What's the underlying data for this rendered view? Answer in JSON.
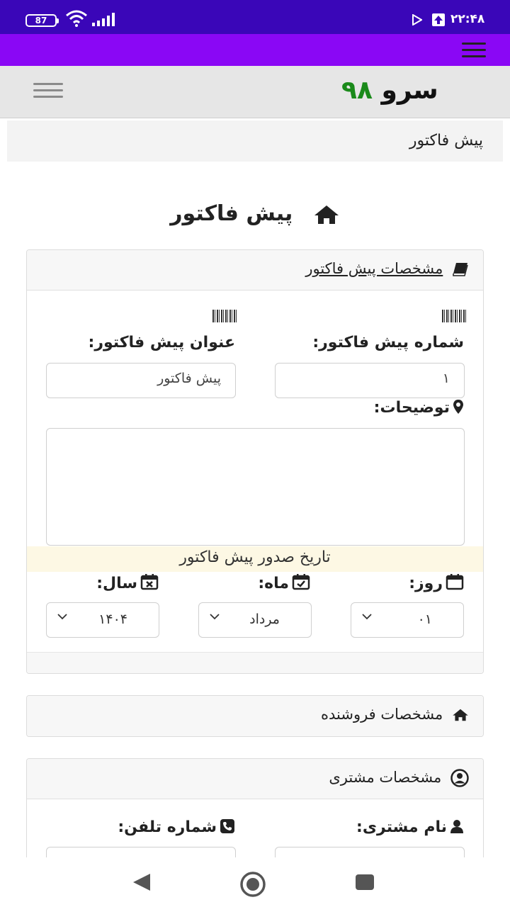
{
  "status_bar": {
    "battery": "87",
    "time": "۲۲:۴۸"
  },
  "header": {
    "logo_word": "سرو",
    "logo_number": "۹۸"
  },
  "breadcrumb": {
    "current": "پیش فاکتور"
  },
  "page": {
    "title": "پیش فاکتور"
  },
  "invoice_card": {
    "header": "مشخصات پیش فاکتور",
    "number_label": "شماره پیش فاکتور:",
    "number_value": "۱",
    "title_label": "عنوان پیش فاکتور:",
    "title_value": "پیش فاکتور",
    "description_label": "توضیحات:",
    "date_section_label": "تاریخ صدور پیش فاکتور",
    "day_label": "روز:",
    "day_value": "۰۱",
    "month_label": "ماه:",
    "month_value": "مرداد",
    "year_label": "سال:",
    "year_value": "۱۴۰۴"
  },
  "seller_card": {
    "header": "مشخصات فروشنده"
  },
  "customer_card": {
    "header": "مشخصات مشتری",
    "name_label": "نام مشتری:",
    "phone_label": "شماره تلفن:"
  },
  "icons": {
    "menu": "hamburger-icon",
    "home": "home-icon",
    "book": "book-icon",
    "barcode": "barcode-icon",
    "marker": "map-marker-icon",
    "calendar": "calendar-icon",
    "user": "user-icon",
    "phone": "phone-icon"
  },
  "colors": {
    "status_bar": "#3a06b8",
    "app_bar": "#8a07f5",
    "logo_number": "#1a8a1a",
    "date_band": "#fdf8e4"
  }
}
